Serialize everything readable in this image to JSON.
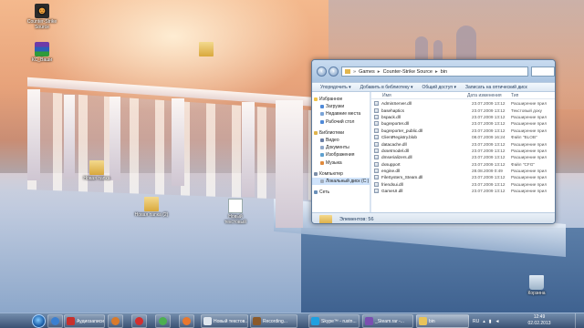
{
  "desktop": {
    "icons": [
      {
        "label": "Counter-Strike Source",
        "icon": "counter-strike-icon"
      },
      {
        "label": "КС_Ваши",
        "icon": "winrar-icon"
      },
      {
        "label": "",
        "icon": "folder-icon"
      },
      {
        "label": "Новая папка",
        "icon": "folder-icon"
      },
      {
        "label": "Новая папка (2)",
        "icon": "folder-icon"
      },
      {
        "label": "Новый текстовый",
        "icon": "text-document-icon"
      },
      {
        "label": "Корзина",
        "icon": "recycle-bin-icon"
      }
    ]
  },
  "explorer": {
    "address": [
      "Games",
      "Counter-Strike Source",
      "bin"
    ],
    "toolbar": [
      "Упорядочить ▾",
      "Добавить в библиотеку ▾",
      "Общий доступ ▾",
      "Записать на оптический диск",
      "Новая папка"
    ],
    "nav": [
      {
        "label": "Избранное",
        "group": true,
        "color": "#f0c44a"
      },
      {
        "label": "Загрузки",
        "group": false,
        "color": "#4f8ad8"
      },
      {
        "label": "Недавние места",
        "group": false,
        "color": "#7aa3d6"
      },
      {
        "label": "Рабочий стол",
        "group": false,
        "color": "#4f8ad8"
      },
      {
        "label": "Библиотеки",
        "group": true,
        "color": "#e0b44c"
      },
      {
        "label": "Видео",
        "group": false,
        "color": "#6b7fa5"
      },
      {
        "label": "Документы",
        "group": false,
        "color": "#8fa7c8"
      },
      {
        "label": "Изображения",
        "group": false,
        "color": "#5ea0cf"
      },
      {
        "label": "Музыка",
        "group": false,
        "color": "#e08a3c"
      },
      {
        "label": "Компьютер",
        "group": true,
        "color": "#7c8ea8"
      },
      {
        "label": "Локальный диск (C:)",
        "group": false,
        "color": "#a0acbc",
        "selected": true
      },
      {
        "label": "Сеть",
        "group": true,
        "color": "#6a8fb8"
      }
    ],
    "columns": {
      "name": "Имя",
      "date": "Дата изменения",
      "type": "Тип"
    },
    "files": [
      {
        "name": "AdminServer.dll",
        "date": "23.07.2009 13:12",
        "type": "Расширение прил"
      },
      {
        "name": "basehaptics",
        "date": "23.07.2009 13:12",
        "type": "Текстовый доку"
      },
      {
        "name": "bspack.dll",
        "date": "23.07.2009 13:12",
        "type": "Расширение прил"
      },
      {
        "name": "bugreporter.dll",
        "date": "23.07.2009 13:12",
        "type": "Расширение прил"
      },
      {
        "name": "bugreporter_public.dll",
        "date": "23.07.2009 13:12",
        "type": "Расширение прил"
      },
      {
        "name": "ClientRegistry.blob",
        "date": "08.07.2009 16:24",
        "type": "Файл \"BLOB\""
      },
      {
        "name": "datacache.dll",
        "date": "23.07.2009 13:12",
        "type": "Расширение прил"
      },
      {
        "name": "dxsetmodel.dll",
        "date": "23.07.2009 13:12",
        "type": "Расширение прил"
      },
      {
        "name": "dmserializers.dll",
        "date": "23.07.2009 13:12",
        "type": "Расширение прил"
      },
      {
        "name": "dxsupport",
        "date": "23.07.2009 13:12",
        "type": "Файл \"CFG\""
      },
      {
        "name": "engine.dll",
        "date": "28.08.2009 0:49",
        "type": "Расширение прил"
      },
      {
        "name": "FileSystem_Steam.dll",
        "date": "23.07.2009 13:12",
        "type": "Расширение прил"
      },
      {
        "name": "friendsui.dll",
        "date": "23.07.2009 13:12",
        "type": "Расширение прил"
      },
      {
        "name": "GameUI.dll",
        "date": "23.07.2009 13:12",
        "type": "Расширение прил"
      }
    ],
    "status": "Элементов: 56"
  },
  "taskbar": {
    "pinned": [
      {
        "name": "ie-icon",
        "color": "#3a7fd0"
      },
      {
        "name": "explorer-pin-icon",
        "color": "#e8c35a"
      },
      {
        "name": "media-player-icon",
        "color": "#d97a2b"
      },
      {
        "name": "opera-icon",
        "color": "#d32f2f"
      },
      {
        "name": "chrome-icon",
        "color": "#4caf50"
      },
      {
        "name": "firefox-icon",
        "color": "#e8772e"
      }
    ],
    "tasks": [
      {
        "label": "Аудиозаписи А...",
        "color": "#c8302c",
        "active": false
      },
      {
        "label": "Новый текстов...",
        "color": "#dfe6ee",
        "active": false
      },
      {
        "label": "Recording...",
        "color": "#8b5a2b",
        "active": false
      },
      {
        "label": "Skype™ - rustn...",
        "color": "#1ea0e0",
        "active": false
      },
      {
        "label": "_Steam.rar -...",
        "color": "#7a4fb0",
        "active": false
      },
      {
        "label": "bin",
        "color": "#e8c35a",
        "active": true
      }
    ],
    "lang": "RU",
    "time": "12:49",
    "date": "02.02.2013"
  }
}
